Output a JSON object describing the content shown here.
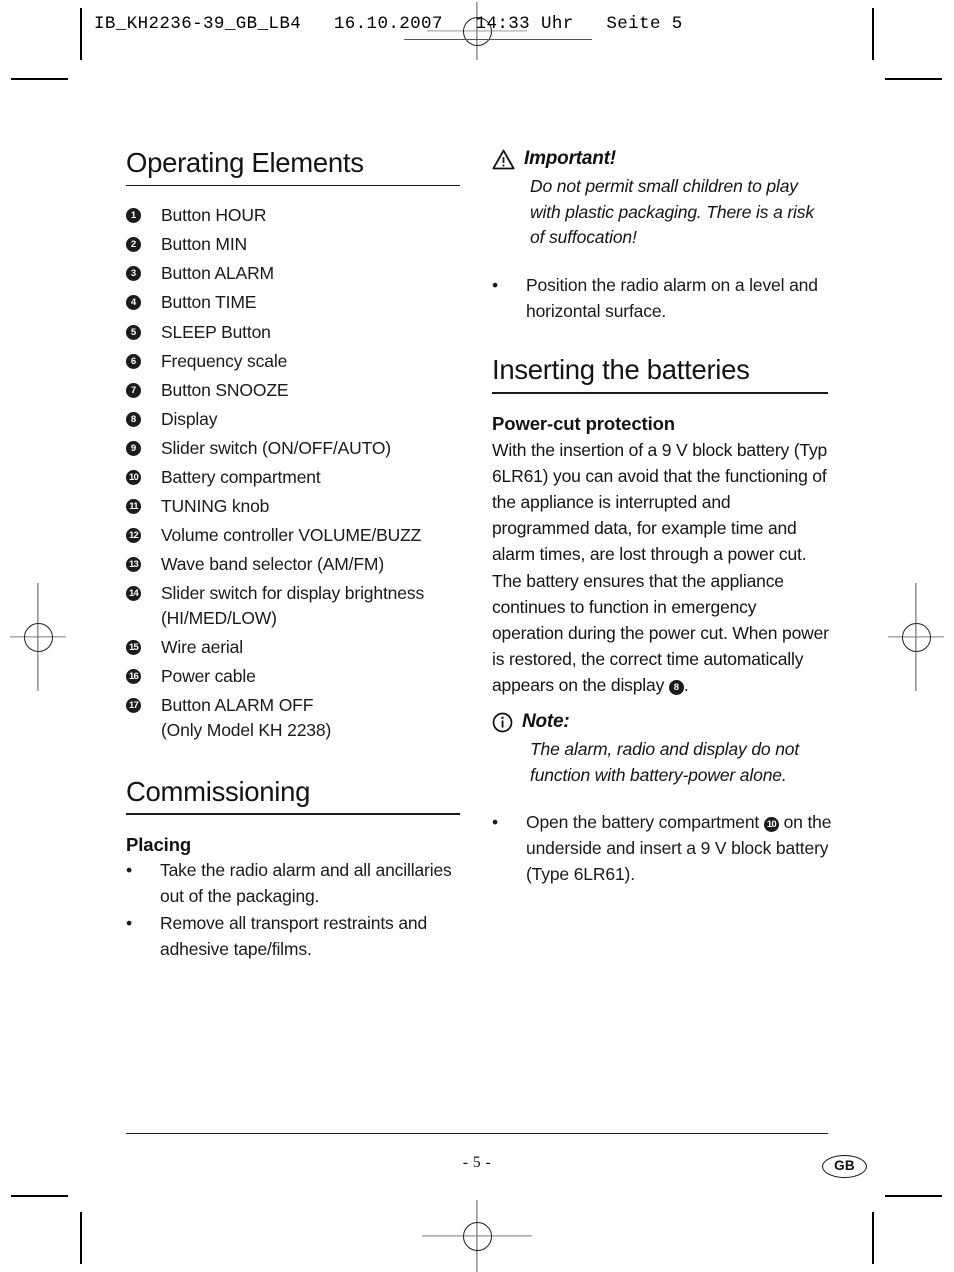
{
  "header": {
    "text": "IB_KH2236-39_GB_LB4   16.10.2007   14:33 Uhr   Seite 5"
  },
  "left_column": {
    "section_title": "Operating Elements",
    "elements": [
      {
        "num": "1",
        "label": "Button HOUR"
      },
      {
        "num": "2",
        "label": "Button MIN"
      },
      {
        "num": "3",
        "label": "Button ALARM"
      },
      {
        "num": "4",
        "label": "Button TIME"
      },
      {
        "num": "5",
        "label": "SLEEP Button"
      },
      {
        "num": "6",
        "label": "Frequency scale"
      },
      {
        "num": "7",
        "label": "Button SNOOZE"
      },
      {
        "num": "8",
        "label": "Display"
      },
      {
        "num": "9",
        "label": "Slider switch (ON/OFF/AUTO)"
      },
      {
        "num": "10",
        "label": "Battery compartment"
      },
      {
        "num": "11",
        "label": "TUNING knob"
      },
      {
        "num": "12",
        "label": "Volume controller VOLUME/BUZZ"
      },
      {
        "num": "13",
        "label": "Wave band selector (AM/FM)"
      },
      {
        "num": "14",
        "label": "Slider switch for display brightness",
        "label_cont": "(HI/MED/LOW)"
      },
      {
        "num": "15",
        "label": "Wire aerial"
      },
      {
        "num": "16",
        "label": "Power cable"
      },
      {
        "num": "17",
        "label": "Button ALARM OFF",
        "label_cont": "(Only Model KH 2238)"
      }
    ],
    "commissioning_title": "Commissioning",
    "placing_title": "Placing",
    "placing_bullets": [
      "Take the radio alarm and all ancillaries out of the packaging.",
      "Remove all transport restraints and adhesive tape/films."
    ],
    "bullet_glyph": "•"
  },
  "right_column": {
    "important": {
      "icon": "warning-triangle-icon",
      "title": "Important!",
      "body": "Do not permit small children to play with plastic packaging. There is a risk of suffocation!"
    },
    "position_bullet": "Position the radio alarm on a level and horizontal surface.",
    "batteries_title": "Inserting the batteries",
    "power_cut_title": "Power-cut protection",
    "power_cut_body_before": "With the insertion of a 9 V block battery (Typ 6LR61) you can avoid that the functioning of the appliance is interrupted and programmed data, for example time and alarm times, are lost through a power cut. The battery ensures that the appliance continues to function in emergency operation during the power cut. When power is restored, the correct time automatically appears on the display ",
    "power_cut_badge": "8",
    "power_cut_body_after": ".",
    "note": {
      "icon": "info-circle-icon",
      "title": "Note:",
      "body": "The alarm, radio and display do not function with battery-power alone."
    },
    "battery_bullet_before": "Open the battery compartment ",
    "battery_bullet_badge": "10",
    "battery_bullet_after": " on the underside and insert a 9 V block battery (Type 6LR61).",
    "bullet_glyph": "•"
  },
  "footer": {
    "page_number": "- 5 -",
    "locale": "GB"
  }
}
